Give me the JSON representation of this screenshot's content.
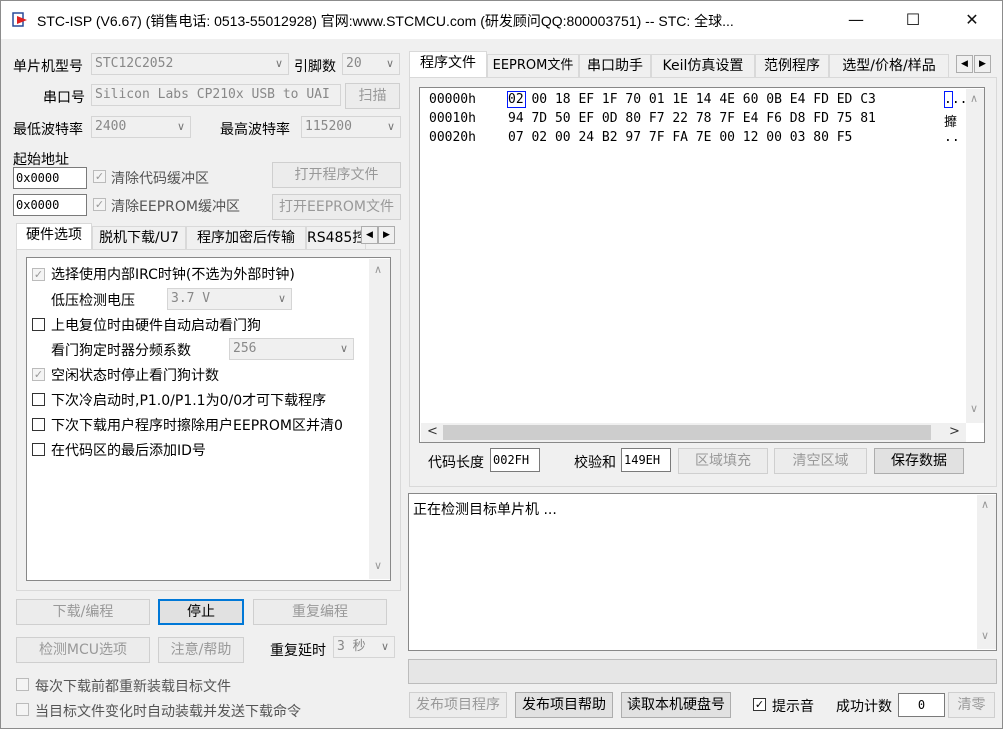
{
  "window": {
    "title": "STC-ISP (V6.67) (销售电话: 0513-55012928) 官网:www.STCMCU.com  (研发顾问QQ:800003751)  -- STC: 全球...",
    "min": "—",
    "max": "☐",
    "close": "✕"
  },
  "left": {
    "mcu_type_label": "单片机型号",
    "mcu_type_value": "STC12C2052",
    "pins_label": "引脚数",
    "pins_value": "20",
    "port_label": "串口号",
    "port_value": "Silicon Labs CP210x USB to UAI",
    "scan_button": "扫描",
    "min_baud_label": "最低波特率",
    "min_baud_value": "2400",
    "max_baud_label": "最高波特率",
    "max_baud_value": "115200",
    "start_addr_label": "起始地址",
    "addr1_value": "0x0000",
    "clear_code_label": "清除代码缓冲区",
    "open_program_button": "打开程序文件",
    "addr2_value": "0x0000",
    "clear_eeprom_label": "清除EEPROM缓冲区",
    "open_eeprom_button": "打开EEPROM文件",
    "tabs": [
      "硬件选项",
      "脱机下载/U7",
      "程序加密后传输",
      "RS485控"
    ],
    "options": {
      "irc": "选择使用内部IRC时钟(不选为外部时钟)",
      "lvd_label": "低压检测电压",
      "lvd_value": "3.7 V",
      "wdt_power": "上电复位时由硬件自动启动看门狗",
      "wdt_div_label": "看门狗定时器分频系数",
      "wdt_div_value": "256",
      "wdt_idle": "空闲状态时停止看门狗计数",
      "cold_boot": "下次冷启动时,P1.0/P1.1为0/0才可下载程序",
      "erase_eeprom": "下次下载用户程序时擦除用户EEPROM区并清0",
      "add_id": "在代码区的最后添加ID号"
    },
    "download_button": "下载/编程",
    "stop_button": "停止",
    "reprogram_button": "重复编程",
    "detect_button": "检测MCU选项",
    "help_button": "注意/帮助",
    "repeat_delay_label": "重复延时",
    "repeat_delay_value": "3 秒",
    "reload_label": "每次下载前都重新装载目标文件",
    "auto_send_label": "当目标文件变化时自动装载并发送下载命令"
  },
  "right": {
    "tabs": [
      "程序文件",
      "EEPROM文件",
      "串口助手",
      "Keil仿真设置",
      "范例程序",
      "选型/价格/样品"
    ],
    "hex_rows": [
      {
        "addr": "00000h",
        "bytes": "02 00 18 EF 1F 70 01 1E 14 4E 60 0B E4 FD ED C3",
        "ascii": "..."
      },
      {
        "addr": "00010h",
        "bytes": "94 7D 50 EF 0D 80 F7 22 78 7F E4 F6 D8 FD 75 81",
        "ascii": "攠"
      },
      {
        "addr": "00020h",
        "bytes": "07 02 00 24 B2 97 7F FA 7E 00 12 00 03 80 F5",
        "ascii": ".."
      }
    ],
    "code_len_label": "代码长度",
    "code_len_value": "002FH",
    "checksum_label": "校验和",
    "checksum_value": "149EH",
    "fill_button": "区域填充",
    "clear_button": "清空区域",
    "save_button": "保存数据",
    "status_text": "正在检测目标单片机 ...",
    "publish_button": "发布项目程序",
    "publish_help_button": "发布项目帮助",
    "read_disk_button": "读取本机硬盘号",
    "sound_label": "提示音",
    "success_label": "成功计数",
    "success_value": "0",
    "clear_count_button": "清零"
  }
}
